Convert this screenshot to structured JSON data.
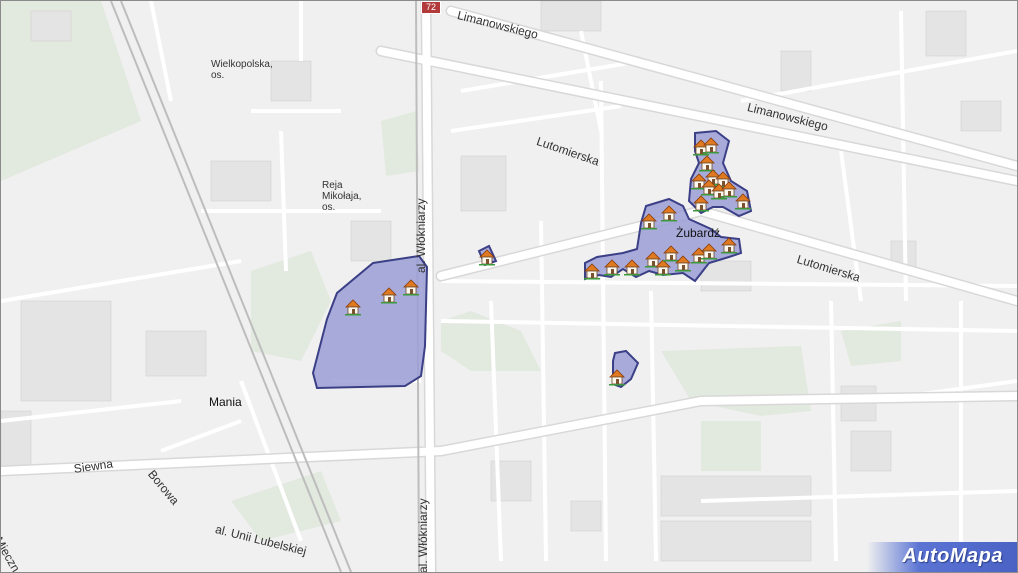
{
  "map": {
    "title": "AutoMapa",
    "road_badge": "72",
    "streets": [
      {
        "id": "limanowskiego-1",
        "text": "Limanowskiego"
      },
      {
        "id": "limanowskiego-2",
        "text": "Limanowskiego"
      },
      {
        "id": "lutomierska-1",
        "text": "Lutomierska"
      },
      {
        "id": "lutomierska-2",
        "text": "Lutomierska"
      },
      {
        "id": "wlokniarzy-1",
        "text": "al. Włókniarzy"
      },
      {
        "id": "wlokniarzy-2",
        "text": "al. Włókniarzy"
      },
      {
        "id": "siewna",
        "text": "Siewna"
      },
      {
        "id": "borowa",
        "text": "Borowa"
      },
      {
        "id": "unii",
        "text": "al. Unii Lubelskiej"
      },
      {
        "id": "mieczn",
        "text": "Mieczn"
      }
    ],
    "places": [
      {
        "id": "wielkopolska",
        "text": "Wielkopolska, os."
      },
      {
        "id": "reja",
        "text": "Reja Mikołaja, os."
      },
      {
        "id": "mania",
        "text": "Mania"
      },
      {
        "id": "zubardz",
        "text": "Żubardź"
      }
    ],
    "marker_icon": "house-icon",
    "colors": {
      "area_fill": "#9b9fd6",
      "area_stroke": "#3b3f86",
      "road": "#ffffff",
      "green": "#d9e3d5",
      "building": "#dcdcdc",
      "background": "#f0f0f0",
      "brand": "#4a62c4"
    }
  }
}
